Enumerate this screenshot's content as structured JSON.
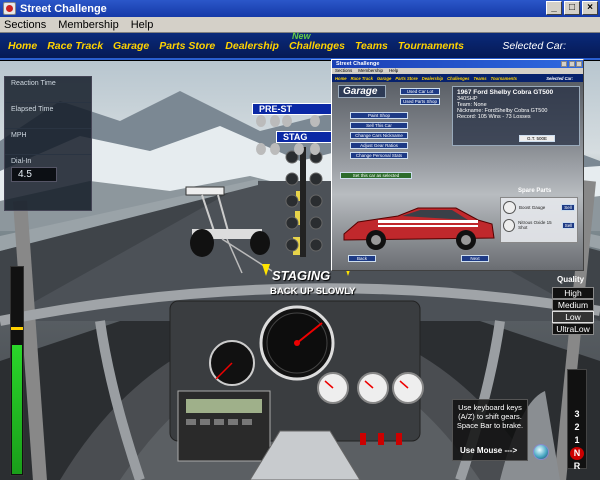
{
  "window": {
    "title": "Street Challenge"
  },
  "menu": [
    "Sections",
    "Membership",
    "Help"
  ],
  "nav": {
    "items": [
      "Home",
      "Race Track",
      "Garage",
      "Parts Store",
      "Dealership",
      "Challenges",
      "Teams",
      "Tournaments"
    ],
    "new_tag": "New",
    "selected_car": "Selected Car:"
  },
  "info_panel": {
    "reaction_time": "Reaction Time",
    "elapsed_time": "Elapsed Time",
    "mph": "MPH",
    "dial_in": "Dial-In",
    "dial_in_value": "4.5"
  },
  "track": {
    "prestage": "PRE-ST",
    "stage": "STAG",
    "staging": "STAGING",
    "backup": "BACK UP SLOWLY"
  },
  "quality": {
    "label": "Quality",
    "options": [
      "High",
      "Medium",
      "Low",
      "UltraLow"
    ],
    "selected": "Low"
  },
  "gears": [
    "3",
    "2",
    "1",
    "N",
    "R"
  ],
  "active_gear": "N",
  "instructions": {
    "text": "Use keyboard keys (A/Z) to shift gears. Space Bar to brake.",
    "use_mouse": "Use Mouse --->"
  },
  "tach": {
    "level": 0.62
  },
  "popup": {
    "title": "Street Challenge",
    "menu": [
      "Sections",
      "Membership",
      "Help"
    ],
    "nav": [
      "Home",
      "Race Track",
      "Garage",
      "Parts Store",
      "Dealership",
      "Challenges",
      "Teams",
      "Tournaments"
    ],
    "selected_car": "Selected Car:",
    "garage_title": "Garage",
    "btn_used_car_lot": "Used Car Lot",
    "btn_used_parts_shop": "Used Parts Shop",
    "buttons": [
      "Paint Shop",
      "Sell This Car",
      "Change Cars Nickname",
      "Adjust Gear Ratios",
      "Change Personal Stats"
    ],
    "set_current": "Set this car as selected",
    "car_name": "1967 Ford Shelby Cobra GT500",
    "car_hp": "340SHP",
    "car_team": "Team: None",
    "car_nick": "Nickname: FordShelby Cobra GT500",
    "car_record": "Record: 105 Wins - 73 Losses",
    "code_button": "G.T. 500E",
    "spare_parts_title": "Spare Parts",
    "spare_parts": [
      "Boost Gauge",
      "Nitrous Oxide 15 Shot"
    ],
    "sell_label": "Sell",
    "back": "Back",
    "next": "Next"
  }
}
